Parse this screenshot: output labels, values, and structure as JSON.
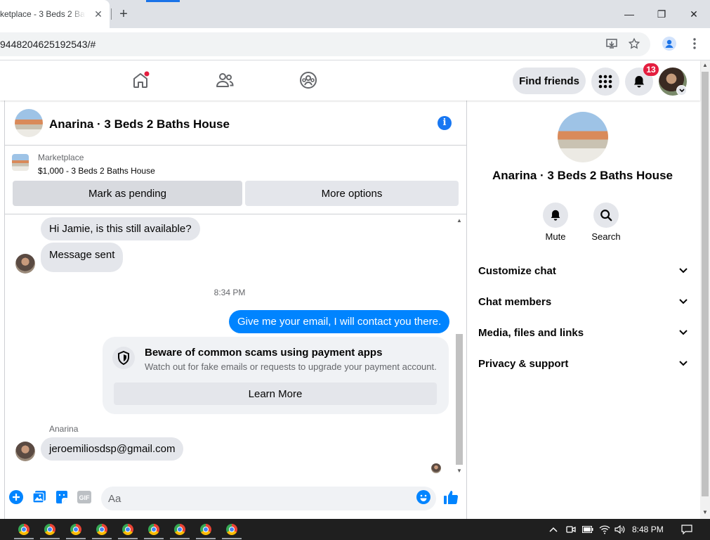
{
  "browser": {
    "tab_title": "ketplace - 3 Beds 2 Bat",
    "tab_close": "✕",
    "new_tab": "+",
    "url": "9448204625192543/#",
    "window": {
      "minimize": "—",
      "restore": "❐",
      "close": "✕"
    }
  },
  "fb_header": {
    "find_friends": "Find friends",
    "notification_count": "13"
  },
  "chat": {
    "title": "Anarina · 3 Beds 2 Baths House",
    "info": "i",
    "marketplace_label": "Marketplace",
    "listing": "$1,000 - 3 Beds 2 Baths House",
    "mark_pending": "Mark as pending",
    "more_options": "More options",
    "messages": {
      "m1": "Hi Jamie, is this still available?",
      "m2": "Message sent",
      "timestamp": "8:34 PM",
      "m3": "Give me your email, I will contact you there.",
      "sender": "Anarina",
      "m4": "jeroemiliosdsp@gmail.com"
    },
    "scam_notice": {
      "title": "Beware of common scams using payment apps",
      "description": "Watch out for fake emails or requests to upgrade your payment account.",
      "button": "Learn More"
    },
    "composer": {
      "placeholder": "Aa",
      "gif": "GIF"
    }
  },
  "info_panel": {
    "title": "Anarina · 3 Beds 2 Baths House",
    "actions": {
      "mute": "Mute",
      "search": "Search"
    },
    "sections": {
      "customize": "Customize chat",
      "members": "Chat members",
      "media": "Media, files and links",
      "privacy": "Privacy & support"
    }
  },
  "taskbar": {
    "time": "8:48 PM"
  },
  "colors": {
    "messenger_blue": "#0084ff",
    "fb_blue": "#1877f2",
    "badge_red": "#e41e3f",
    "light_gray": "#e4e6eb"
  },
  "icons": [
    "home-icon",
    "friends-icon",
    "groups-icon",
    "menu-grid-icon",
    "bell-icon",
    "info-icon",
    "shield-icon",
    "plus-icon",
    "photo-icon",
    "sticker-icon",
    "gif-icon",
    "emoji-icon",
    "like-icon",
    "mute-bell-icon",
    "search-icon",
    "chevron-down-icon",
    "chrome-icon"
  ]
}
